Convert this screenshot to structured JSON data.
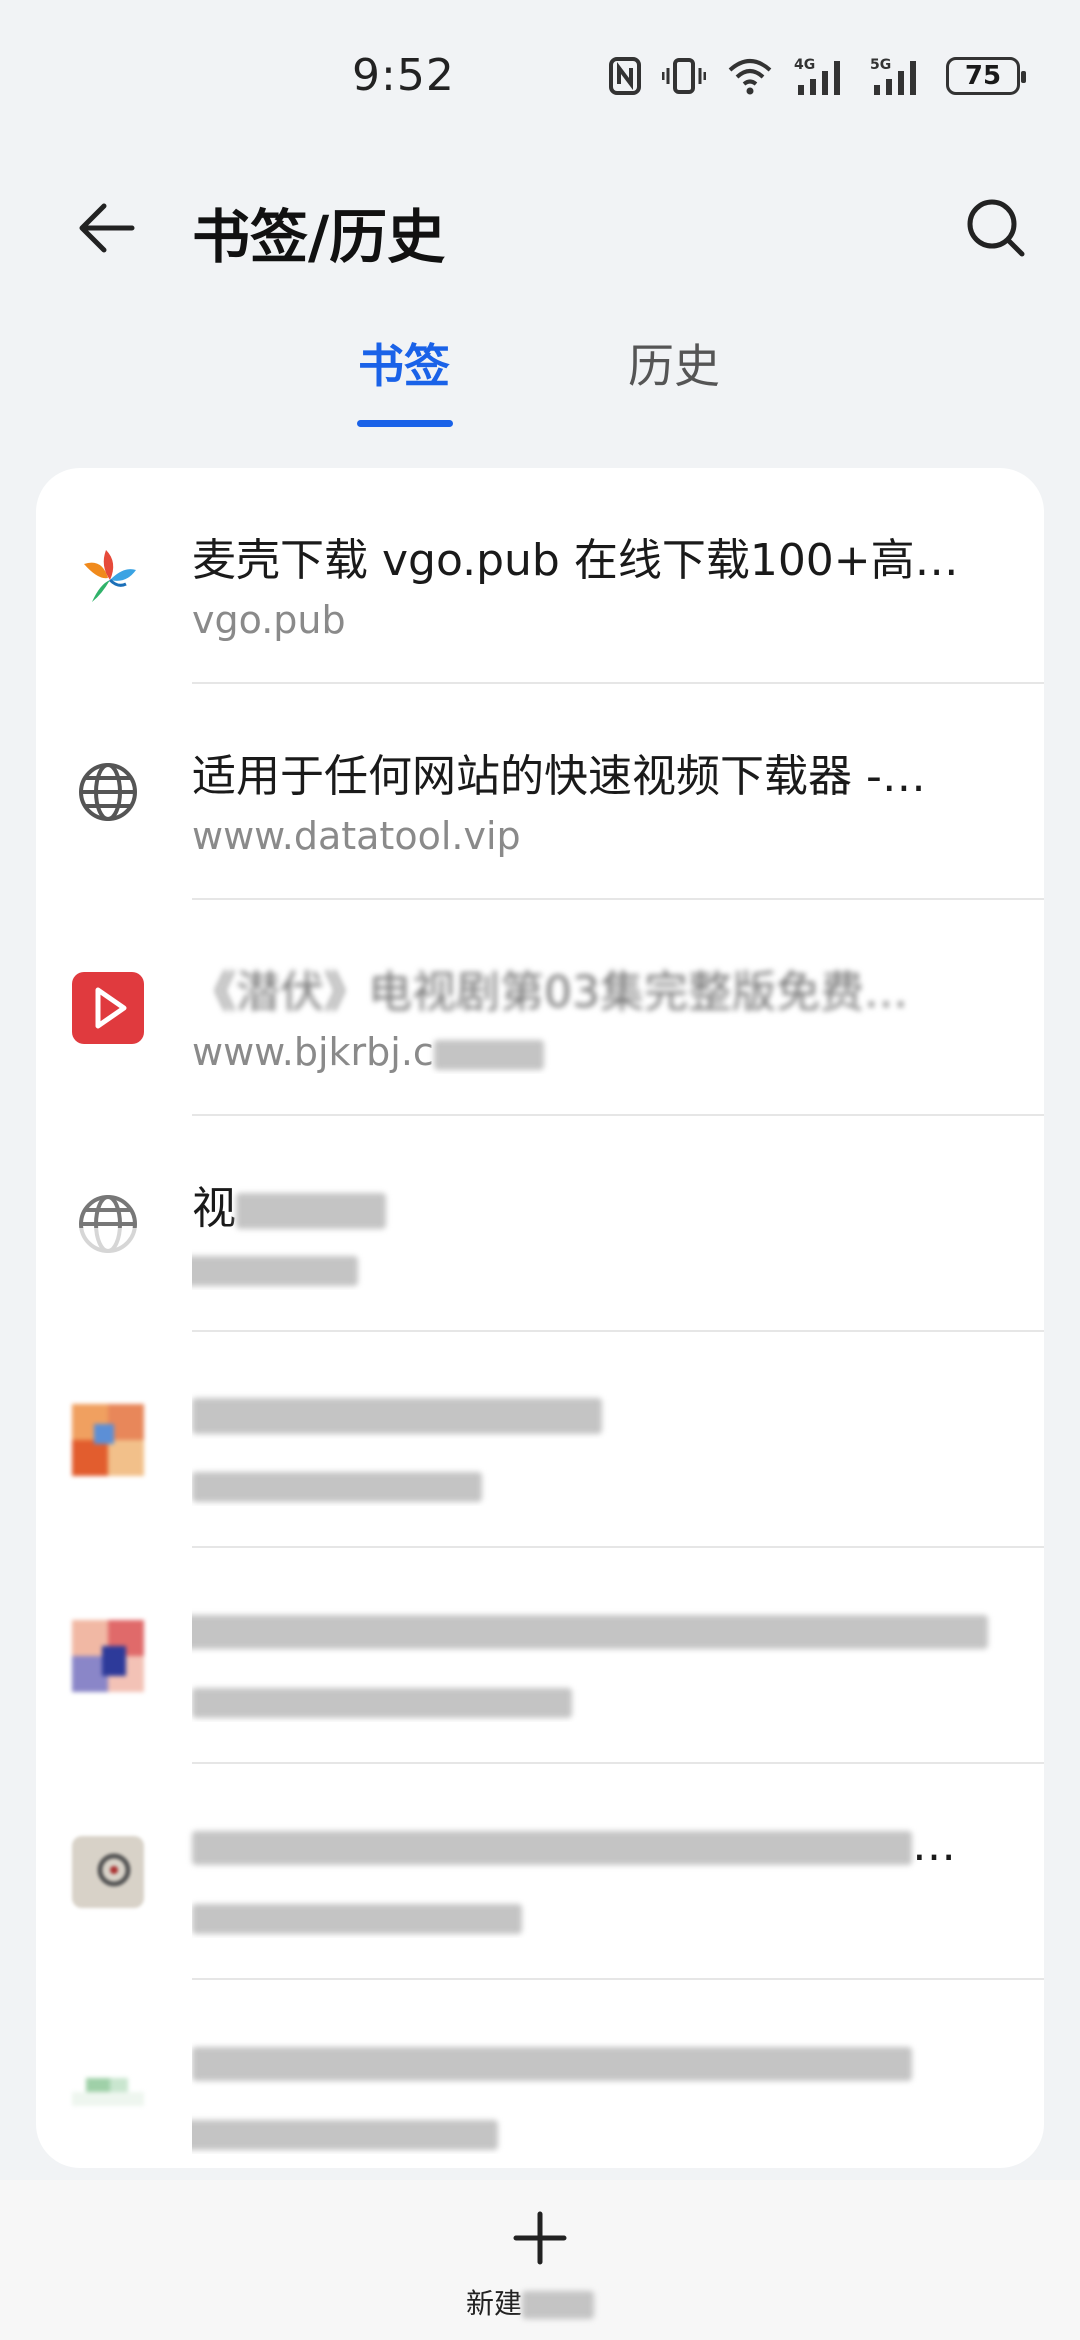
{
  "status": {
    "time": "9:52",
    "battery": "75",
    "net1": "4G",
    "net2": "5G"
  },
  "header": {
    "title": "书签/历史"
  },
  "tabs": [
    {
      "label": "书签",
      "active": true
    },
    {
      "label": "历史",
      "active": false
    }
  ],
  "bookmarks": [
    {
      "title": "麦壳下载 vgo.pub 在线下载100+高…",
      "url": "vgo.pub",
      "icon": "bird-logo-icon"
    },
    {
      "title": "适用于任何网站的快速视频下载器 -…",
      "url": "www.datatool.vip",
      "icon": "globe-icon"
    },
    {
      "title": "《潜伏》电视剧第03集完整版免费…",
      "url": "www.bjkrbj.c",
      "icon": "video-play-icon"
    },
    {
      "title": "视",
      "url": "",
      "icon": "globe-icon"
    },
    {
      "title": "",
      "url": "",
      "icon": "colored-tiles-icon"
    },
    {
      "title": "",
      "url": "",
      "icon": "colored-tiles-icon"
    },
    {
      "title": "…",
      "url": "",
      "icon": "gray-badge-icon"
    },
    {
      "title": "",
      "url": "",
      "icon": "green-tiles-icon"
    }
  ],
  "footer": {
    "new_label": "新建"
  },
  "colors": {
    "accent": "#1a62e8",
    "background": "#f1f3f5"
  }
}
